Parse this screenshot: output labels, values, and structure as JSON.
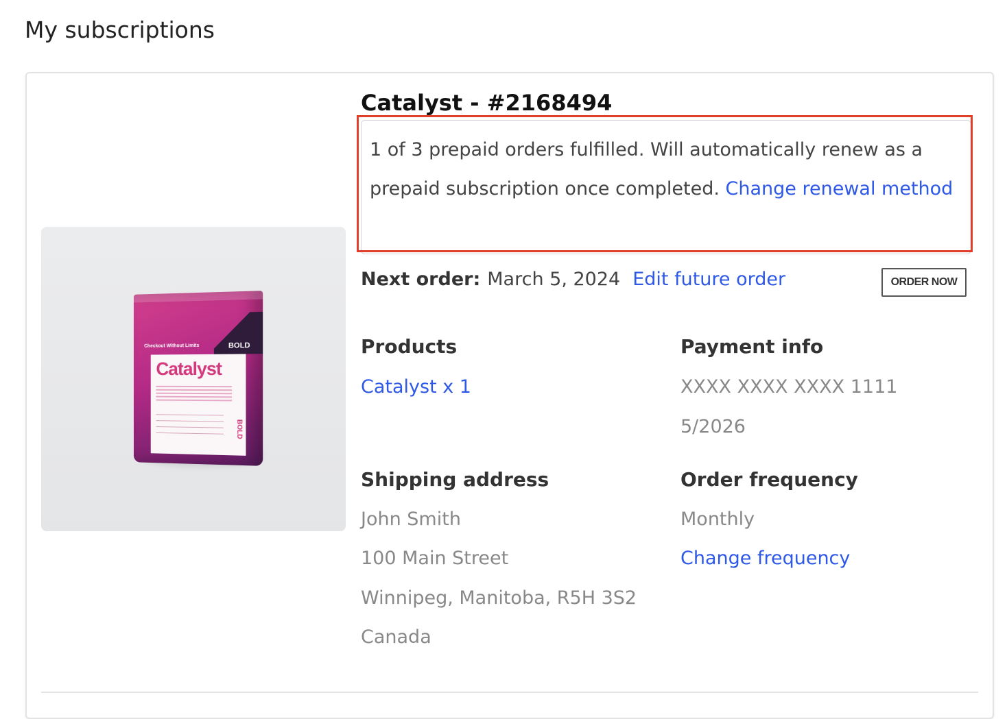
{
  "page": {
    "title": "My subscriptions"
  },
  "subscription": {
    "title": "Catalyst - #2168494",
    "notice": {
      "text": "1 of 3 prepaid orders fulfilled. Will automatically renew as a prepaid subscription once completed.",
      "link_label": "Change renewal method"
    },
    "next_order": {
      "label": "Next order:",
      "date": "March 5, 2024",
      "edit_label": "Edit future order",
      "order_now_label": "ORDER NOW"
    },
    "products": {
      "heading": "Products",
      "item_label": "Catalyst x 1"
    },
    "payment": {
      "heading": "Payment info",
      "card_number": "XXXX XXXX XXXX 1111",
      "expiry": "5/2026"
    },
    "shipping": {
      "heading": "Shipping address",
      "name": "John Smith",
      "street": "100 Main Street",
      "city_line": "Winnipeg, Manitoba, R5H 3S2",
      "country": "Canada"
    },
    "frequency": {
      "heading": "Order frequency",
      "value": "Monthly",
      "change_label": "Change frequency"
    }
  },
  "product_image": {
    "tagline": "Checkout Without Limits",
    "brand": "BOLD",
    "name": "Catalyst"
  },
  "colors": {
    "link": "#2e58e6",
    "highlight": "#e0402a",
    "pouch": "#b42a86"
  }
}
